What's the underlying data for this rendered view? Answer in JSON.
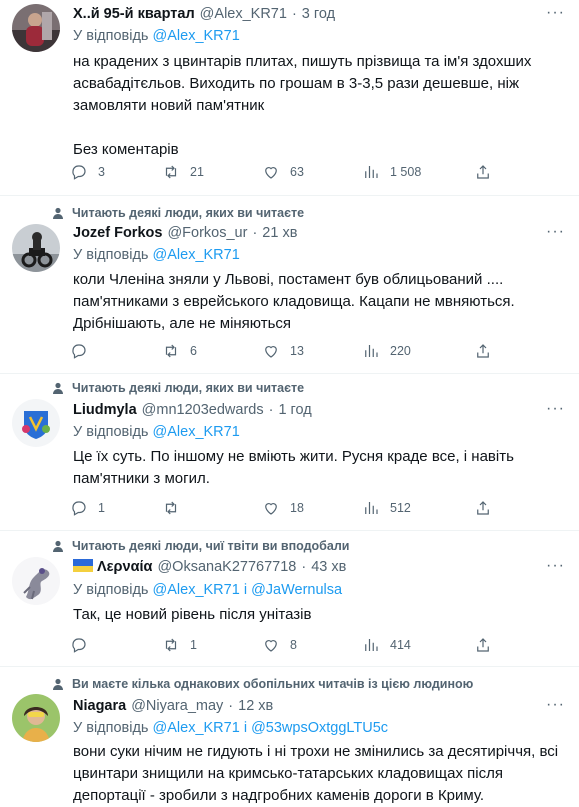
{
  "tweets": [
    {
      "author": {
        "name": "Х..й 95-й квартал",
        "handle": "@Alex_KR71",
        "time": "3 год"
      },
      "reply_prefix": "У відповідь",
      "reply_to": [
        "@Alex_KR71"
      ],
      "body": [
        "на крадених з цвинтарів плитах, пишуть прізвища та ім'я здохших",
        "асвабадітєльов. Виходить по грошам в 3-3,5 рази дешевше, ніж",
        "замовляти новий пам'ятник",
        "",
        "Без коментарів"
      ],
      "stats": {
        "replies": "3",
        "retweets": "21",
        "likes": "63",
        "views": "1 508"
      }
    },
    {
      "social_context": "Читають деякі люди, яких ви читаєте",
      "author": {
        "name": "Jozef Forkos",
        "handle": "@Forkos_ur",
        "time": "21 хв"
      },
      "reply_prefix": "У відповідь",
      "reply_to": [
        "@Alex_KR71"
      ],
      "body": [
        "коли Членіна зняли у Львові, постамент був облицьований ....",
        "пам'ятниками з еврейського кладовища. Кацапи не мвняються.",
        "Дрібнішають, але не міняються"
      ],
      "stats": {
        "replies": "",
        "retweets": "6",
        "likes": "13",
        "views": "220"
      }
    },
    {
      "social_context": "Читають деякі люди, яких ви читаєте",
      "author": {
        "name": "Liudmyla",
        "handle": "@mn1203edwards",
        "time": "1 год"
      },
      "reply_prefix": "У відповідь",
      "reply_to": [
        "@Alex_KR71"
      ],
      "body": [
        "Це їх суть. По іншому не вміють жити.  Русня краде все, і навіть",
        "пам'ятники з могил."
      ],
      "stats": {
        "replies": "1",
        "retweets": "",
        "likes": "18",
        "views": "512"
      }
    },
    {
      "social_context": "Читають деякі люди, чиї твіти ви вподобали",
      "author": {
        "name": "Λερναία",
        "handle": "@OksanaK27767718",
        "time": "43 хв"
      },
      "reply_prefix": "У відповідь",
      "reply_to": [
        "@Alex_KR71",
        "@JaWernulsa"
      ],
      "reply_joiner": "і",
      "body": [
        "Так, це новий рівень після унітазів"
      ],
      "stats": {
        "replies": "",
        "retweets": "1",
        "likes": "8",
        "views": "414"
      }
    },
    {
      "social_context": "Ви маєте кілька однакових обопільних читачів із цією людиною",
      "author": {
        "name": "Niagara",
        "handle": "@Niyara_may",
        "time": "12 хв"
      },
      "reply_prefix": "У відповідь",
      "reply_to": [
        "@Alex_KR71",
        "@53wpsOxtggLTU5c"
      ],
      "reply_joiner": "і",
      "body": [
        "вони суки нічим не гидують і ні трохи не змінились за десятиріччя, всі",
        "цвинтари знищили на кримсько-татарських кладовищах після",
        "депортації -  зробили з надгробних каменів дороги в Криму."
      ]
    }
  ],
  "colors": {
    "accent": "#1d9bf0",
    "secondary_text": "#536471",
    "primary_text": "#0f1419",
    "divider": "#eff3f4"
  },
  "icons": [
    "person-icon",
    "reply-icon",
    "retweet-icon",
    "like-icon",
    "views-icon",
    "share-icon",
    "more-icon"
  ]
}
